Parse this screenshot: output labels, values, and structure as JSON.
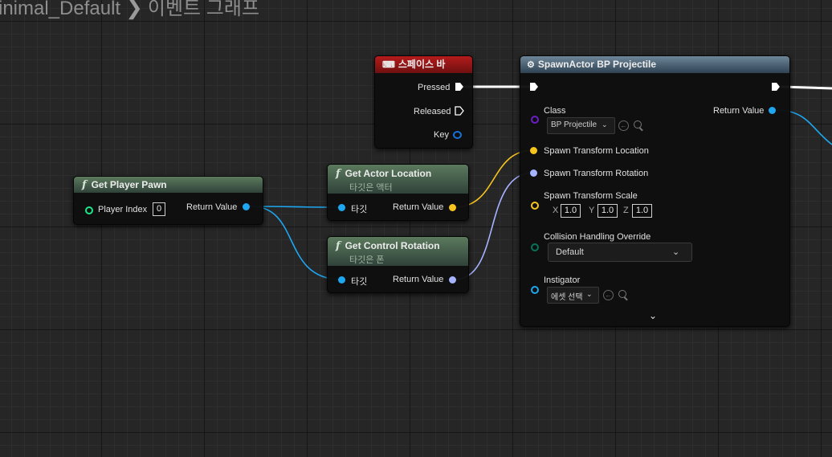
{
  "breadcrumb": {
    "parent": "inimal_Default",
    "current": "이벤트 그래프"
  },
  "colors": {
    "exec": "#ffffff",
    "object": "#1ea7f0",
    "vector": "#f8c51e",
    "rotator": "#a6b3ff",
    "transform": "#f8c51e",
    "class": "#6c1ec6",
    "byte": "#08735b",
    "int": "#1ee68a",
    "func_header": "#4f6d53",
    "event_header": "#a61818",
    "spawn_header": "#5e788c"
  },
  "nodes": {
    "get_player_pawn": {
      "title": "Get Player Pawn",
      "player_index_label": "Player Index",
      "player_index_value": "0",
      "return_label": "Return Value"
    },
    "spacebar_event": {
      "title": "스페이스 바",
      "pressed": "Pressed",
      "released": "Released",
      "key": "Key"
    },
    "get_actor_location": {
      "title": "Get Actor Location",
      "subtitle": "타깃은 액터",
      "target": "타깃",
      "return_label": "Return Value"
    },
    "get_control_rotation": {
      "title": "Get Control Rotation",
      "subtitle": "타깃은 폰",
      "target": "타깃",
      "return_label": "Return Value"
    },
    "spawn_actor": {
      "title": "SpawnActor BP Projectile",
      "class_label": "Class",
      "class_value": "BP Projectile",
      "return_label": "Return Value",
      "location_label": "Spawn Transform Location",
      "rotation_label": "Spawn Transform Rotation",
      "scale_label": "Spawn Transform Scale",
      "scale_x_label": "X",
      "scale_x": "1.0",
      "scale_y_label": "Y",
      "scale_y": "1.0",
      "scale_z_label": "Z",
      "scale_z": "1.0",
      "collision_label": "Collision Handling Override",
      "collision_value": "Default",
      "instigator_label": "Instigator",
      "instigator_value": "에셋 선택"
    }
  }
}
